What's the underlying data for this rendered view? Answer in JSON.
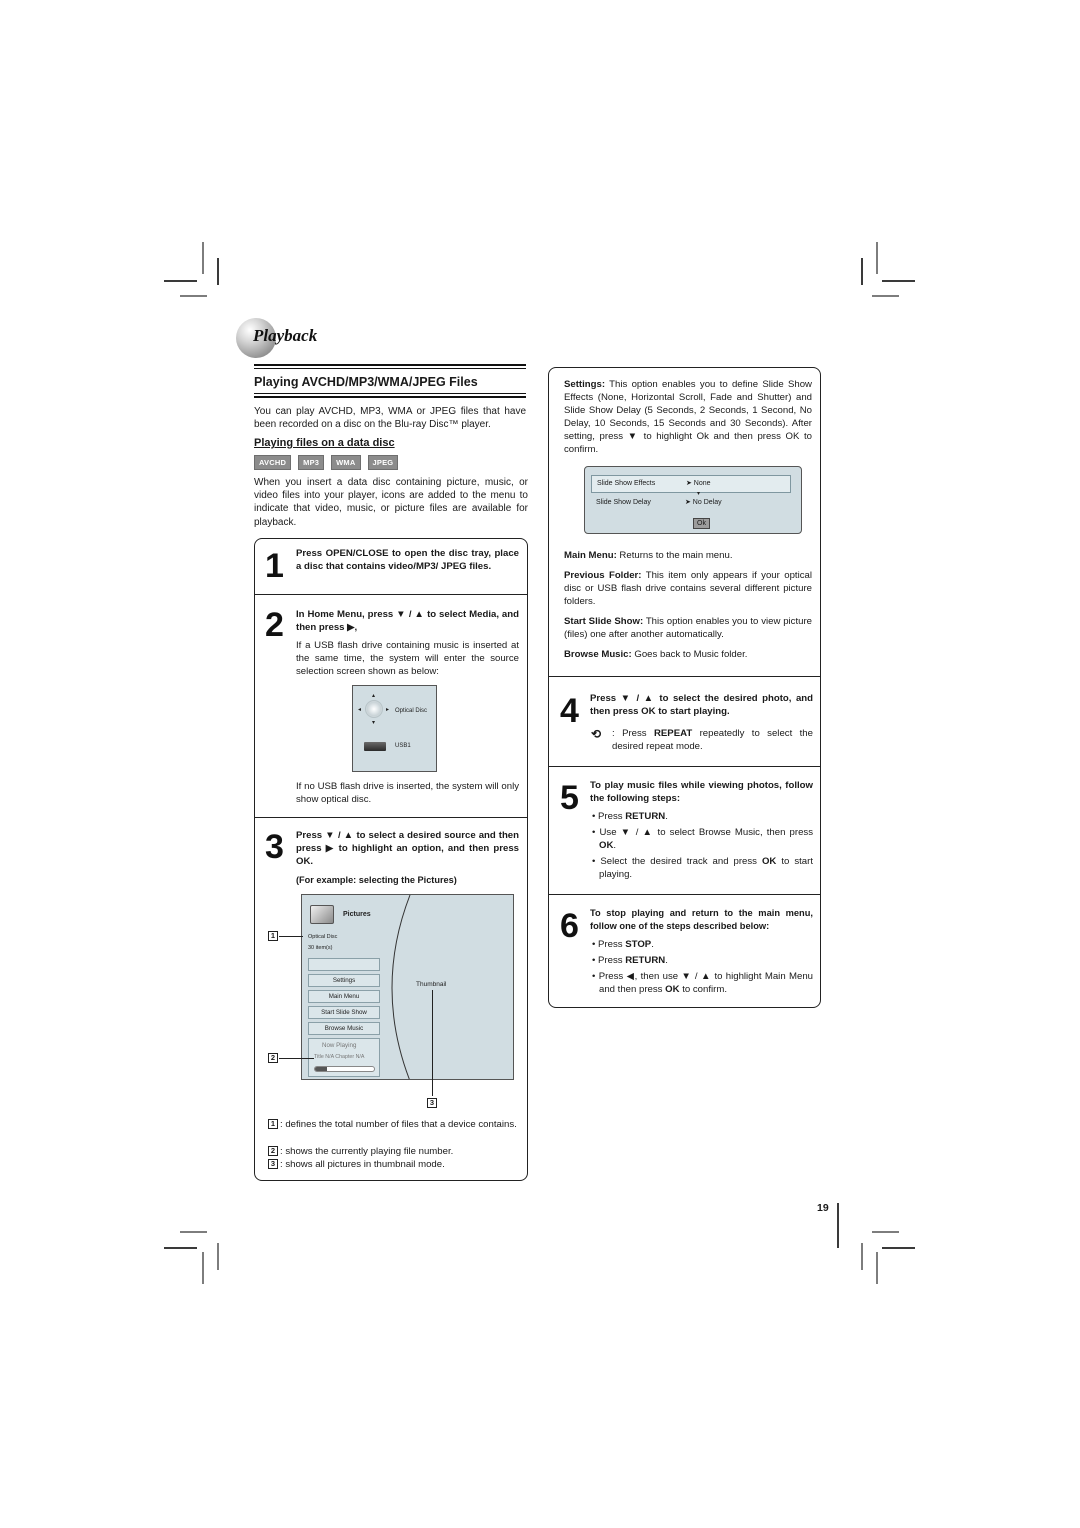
{
  "header": {
    "title": "Playback"
  },
  "section": {
    "title": "Playing AVCHD/MP3/WMA/JPEG Files",
    "intro": "You can play AVCHD, MP3, WMA or JPEG files that have been recorded on a disc on the Blu-ray Disc™ player.",
    "subheading": "Playing files on a data disc",
    "badges": [
      "AVCHD",
      "MP3",
      "WMA",
      "JPEG"
    ],
    "description": "When you insert a data disc containing picture, music, or video files into your player, icons are added to the menu to indicate that video, music, or picture files are available for playback."
  },
  "steps": [
    {
      "number": "1",
      "instruction": "Press OPEN/CLOSE to open the disc tray, place a disc that contains video/MP3/ JPEG files."
    },
    {
      "number": "2",
      "instruction": "In Home Menu, press ▼ / ▲ to select Media, and then press ▶,",
      "body": "If a USB flash drive containing music is inserted at the same time, the system will enter the source selection screen shown as below:",
      "after": "If no USB flash drive is inserted, the system will only show optical disc."
    },
    {
      "number": "3",
      "instruction": "Press ▼ / ▲ to select a desired source and then press ▶ to highlight an option, and then press OK.",
      "example": "(For example: selecting the Pictures)"
    },
    {
      "number": "4",
      "instruction": "Press ▼ / ▲ to select the desired photo, and then press OK to start playing.",
      "repeat_note_pre": "Press ",
      "repeat_note_bold": "REPEAT",
      "repeat_note_post": " repeatedly to select the desired repeat mode."
    },
    {
      "number": "5",
      "instruction": "To play music files while viewing photos, follow the following steps:",
      "bullets": [
        {
          "pre": "Press ",
          "bold": "RETURN",
          "post": "."
        },
        {
          "pre": "Use ▼ / ▲ to select Browse Music, then press ",
          "bold": "OK",
          "post": "."
        },
        {
          "pre": "Select the desired track and press ",
          "bold": "OK",
          "post": " to start playing."
        }
      ]
    },
    {
      "number": "6",
      "instruction": "To stop playing and return to the main menu, follow one of the steps described below:",
      "bullets": [
        {
          "pre": "Press ",
          "bold": "STOP",
          "post": "."
        },
        {
          "pre": "Press ",
          "bold": "RETURN",
          "post": "."
        },
        {
          "pre": "Press ◀, then use ▼ / ▲ to highlight Main Menu and then press ",
          "bold": "OK",
          "post": " to confirm."
        }
      ]
    }
  ],
  "source_screen": {
    "items": [
      "Optical Disc",
      "USB1"
    ]
  },
  "pictures_screen": {
    "title": "Pictures",
    "device": "Optical Disc",
    "count": "30 item(s)",
    "menu": [
      "Settings",
      "Main Menu",
      "Start Slide Show",
      "Browse Music"
    ],
    "now_playing": "Now Playing",
    "now_playing_info": "Title N/A   Chapter N/A",
    "progress": 0.2,
    "thumbnail_label": "Thumbnail"
  },
  "callouts": [
    {
      "id": "1",
      "text": ": defines the total number of files that a device contains."
    },
    {
      "id": "2",
      "text": ": shows the currently playing file number."
    },
    {
      "id": "3",
      "text": ": shows all pictures in thumbnail mode."
    }
  ],
  "right_column": {
    "settings_label": "Settings:",
    "settings_text": " This option enables you to define Slide Show Effects (None, Horizontal Scroll, Fade and Shutter) and Slide Show Delay (5 Seconds, 2 Seconds, 1 Second, No Delay, 10 Seconds, 15 Seconds and 30 Seconds). After setting, press ▼ to highlight Ok and then press OK to confirm.",
    "settings_screen": {
      "rows": [
        {
          "label": "Slide Show Effects",
          "value": "➤ None"
        },
        {
          "label": "Slide Show Delay",
          "value": "➤ No Delay"
        }
      ],
      "ok": "Ok"
    },
    "main_menu_label": "Main Menu:",
    "main_menu_text": " Returns to the main menu.",
    "prev_folder_label": "Previous Folder:",
    "prev_folder_text": " This item only appears if your optical disc or USB flash drive contains several different picture folders.",
    "slide_show_label": "Start Slide Show:",
    "slide_show_text": " This option enables you to view picture (files) one after another automatically.",
    "browse_music_label": "Browse Music:",
    "browse_music_text": " Goes back to Music folder."
  },
  "page_number": "19"
}
